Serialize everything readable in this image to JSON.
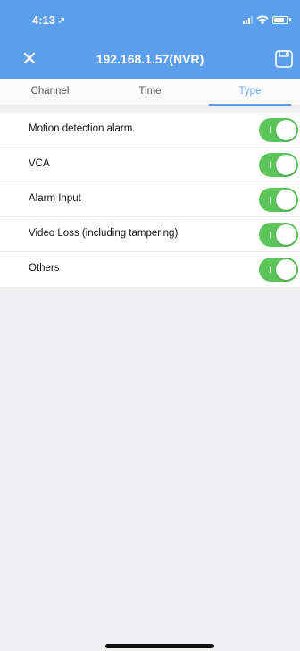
{
  "status_bar": {
    "time": "4:13",
    "location_arrow": "↗"
  },
  "nav": {
    "close_icon": "✕",
    "title": "192.168.1.57(NVR)"
  },
  "tabs": [
    {
      "label": "Channel",
      "active": false
    },
    {
      "label": "Time",
      "active": false
    },
    {
      "label": "Type",
      "active": true
    }
  ],
  "alarm_types": [
    {
      "label": "Motion detection alarm.",
      "enabled": true
    },
    {
      "label": "VCA",
      "enabled": true
    },
    {
      "label": "Alarm Input",
      "enabled": true
    },
    {
      "label": "Video Loss (including tampering)",
      "enabled": true
    },
    {
      "label": "Others",
      "enabled": true
    }
  ],
  "colors": {
    "header": "#5b9eec",
    "toggle_on": "#5bc55a",
    "tab_active": "#6aa8ee"
  }
}
